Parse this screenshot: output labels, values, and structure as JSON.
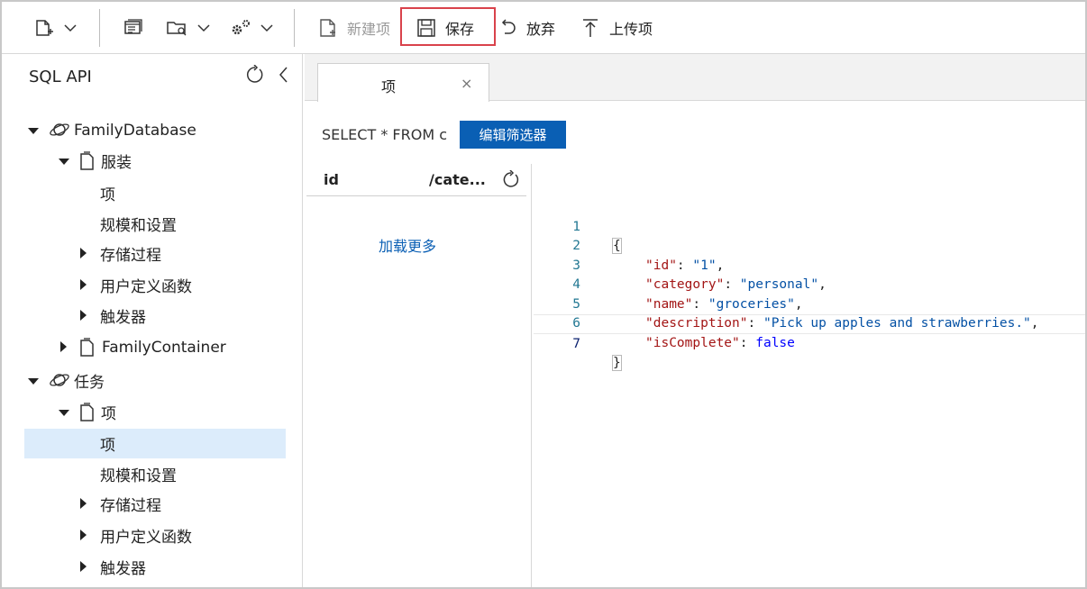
{
  "toolbar": {
    "new_item": "新建项",
    "save": "保存",
    "discard": "放弃",
    "upload": "上传项"
  },
  "sidebar": {
    "title": "SQL API",
    "tree": [
      {
        "label": "FamilyDatabase"
      },
      {
        "label": "服装"
      },
      {
        "label": "项"
      },
      {
        "label": "规模和设置"
      },
      {
        "label": "存储过程"
      },
      {
        "label": "用户定义函数"
      },
      {
        "label": "触发器"
      },
      {
        "label": "FamilyContainer"
      },
      {
        "label": "任务"
      },
      {
        "label": "项"
      },
      {
        "label": "项"
      },
      {
        "label": "规模和设置"
      },
      {
        "label": "存储过程"
      },
      {
        "label": "用户定义函数"
      },
      {
        "label": "触发器"
      }
    ]
  },
  "tabs": [
    {
      "label": "项",
      "close": "×"
    }
  ],
  "query": {
    "text": "SELECT * FROM c",
    "filter_button": "编辑筛选器"
  },
  "list": {
    "col_id": "id",
    "col_partition": "/cate...",
    "load_more": "加载更多"
  },
  "editor": {
    "line_numbers": [
      "1",
      "2",
      "3",
      "4",
      "5",
      "6",
      "7"
    ],
    "document": {
      "open": "{",
      "fields": [
        {
          "key": "\"id\"",
          "value": "\"1\"",
          "comma": ","
        },
        {
          "key": "\"category\"",
          "value": "\"personal\"",
          "comma": ","
        },
        {
          "key": "\"name\"",
          "value": "\"groceries\"",
          "comma": ","
        },
        {
          "key": "\"description\"",
          "value": "\"Pick up apples and strawberries.\"",
          "comma": ","
        },
        {
          "key": "\"isComplete\"",
          "value": "false",
          "comma": ""
        }
      ],
      "close": "}"
    }
  },
  "colors": {
    "accent": "#0a5fb4",
    "save_highlight": "#d9424b",
    "selected_row": "#dcecfb",
    "json_key": "#a31515",
    "json_string": "#0451a5",
    "json_boolean": "#0000ff"
  }
}
